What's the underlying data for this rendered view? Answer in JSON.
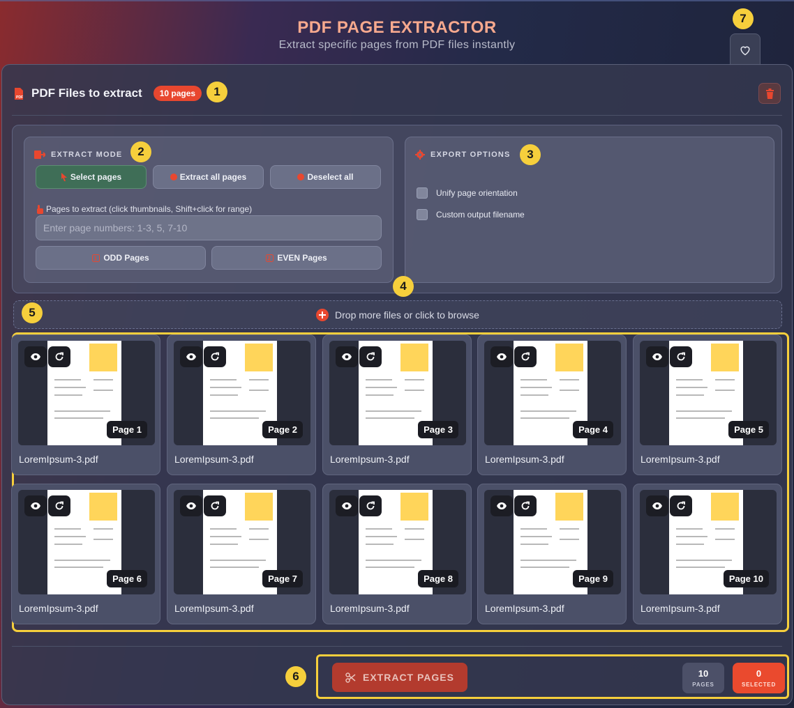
{
  "header": {
    "title": "PDF PAGE EXTRACTOR",
    "subtitle": "Extract specific pages from PDF files instantly"
  },
  "files": {
    "title": "PDF Files to extract",
    "badge": "10 pages"
  },
  "extract_mode": {
    "title": "EXTRACT MODE",
    "buttons": [
      "Select pages",
      "Extract all pages",
      "Deselect all"
    ],
    "active": "Select pages",
    "pages_label": "Pages to extract (click thumbnails, Shift+click for range)",
    "pages_input": {
      "value": "",
      "placeholder": "Enter page numbers: 1-3, 5, 7-10"
    },
    "odd_label": "ODD Pages",
    "even_label": "EVEN Pages"
  },
  "export_options": {
    "title": "EXPORT OPTIONS",
    "options": [
      {
        "label": "Unify page orientation",
        "checked": false
      },
      {
        "label": "Custom output filename",
        "checked": false
      }
    ]
  },
  "dropzone": {
    "label": "Drop more files or click to browse"
  },
  "thumbnails": [
    {
      "page": "Page 1",
      "file": "LoremIpsum-3.pdf"
    },
    {
      "page": "Page 2",
      "file": "LoremIpsum-3.pdf"
    },
    {
      "page": "Page 3",
      "file": "LoremIpsum-3.pdf"
    },
    {
      "page": "Page 4",
      "file": "LoremIpsum-3.pdf"
    },
    {
      "page": "Page 5",
      "file": "LoremIpsum-3.pdf"
    },
    {
      "page": "Page 6",
      "file": "LoremIpsum-3.pdf"
    },
    {
      "page": "Page 7",
      "file": "LoremIpsum-3.pdf"
    },
    {
      "page": "Page 8",
      "file": "LoremIpsum-3.pdf"
    },
    {
      "page": "Page 9",
      "file": "LoremIpsum-3.pdf"
    },
    {
      "page": "Page 10",
      "file": "LoremIpsum-3.pdf"
    }
  ],
  "footer": {
    "extract_label": "EXTRACT PAGES",
    "pages_count": "10",
    "pages_label": "PAGES",
    "selected_count": "0",
    "selected_label": "SELECTED"
  },
  "callouts": [
    "1",
    "2",
    "3",
    "4",
    "5",
    "6",
    "7"
  ],
  "colors": {
    "accent": "#e8472f",
    "highlight": "#f6cf3c",
    "active_mode": "#3f6e57"
  }
}
